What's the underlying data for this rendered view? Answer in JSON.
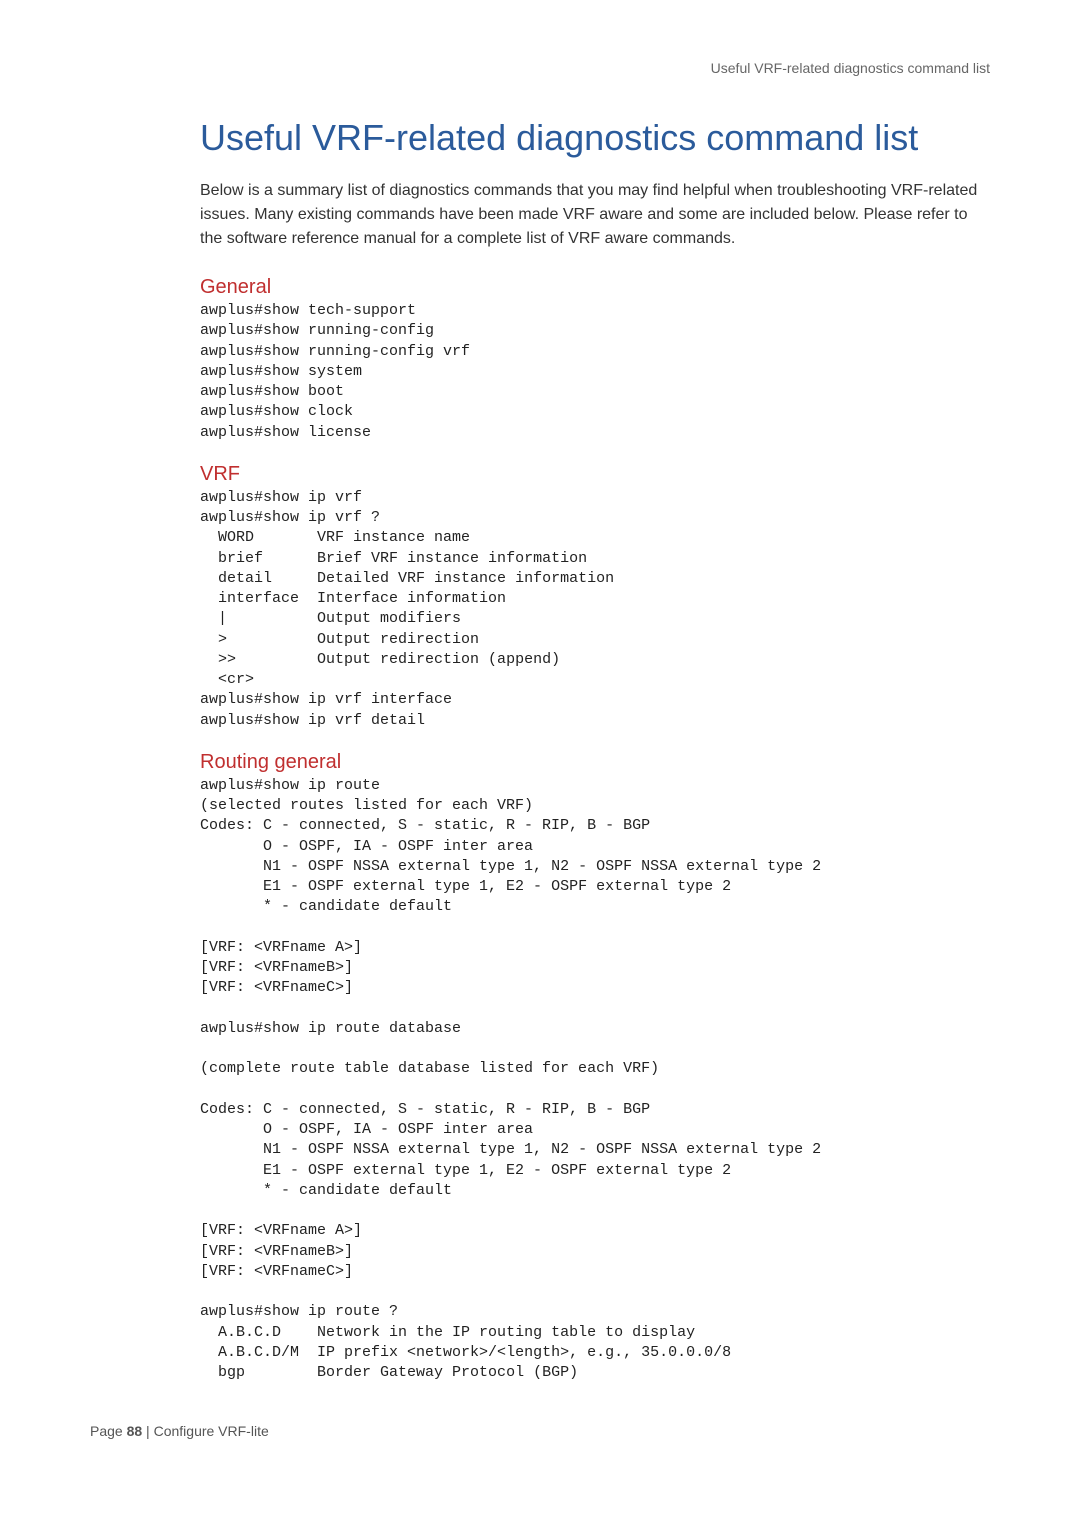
{
  "running_head": "Useful VRF-related diagnostics command list",
  "title": "Useful VRF-related diagnostics command list",
  "intro": "Below is a summary list of diagnostics commands that you may find helpful when troubleshooting VRF-related issues. Many existing commands have been made VRF aware and some are included below. Please refer to the software reference manual for a complete list of VRF aware commands.",
  "sections": {
    "general": {
      "heading": "General",
      "code": "awplus#show tech-support\nawplus#show running-config\nawplus#show running-config vrf\nawplus#show system\nawplus#show boot\nawplus#show clock\nawplus#show license"
    },
    "vrf": {
      "heading": "VRF",
      "code": "awplus#show ip vrf\nawplus#show ip vrf ?\n  WORD       VRF instance name\n  brief      Brief VRF instance information\n  detail     Detailed VRF instance information\n  interface  Interface information\n  |          Output modifiers\n  >          Output redirection\n  >>         Output redirection (append)\n  <cr>\nawplus#show ip vrf interface\nawplus#show ip vrf detail"
    },
    "routing": {
      "heading": "Routing general",
      "code": "awplus#show ip route\n(selected routes listed for each VRF)\nCodes: C - connected, S - static, R - RIP, B - BGP\n       O - OSPF, IA - OSPF inter area\n       N1 - OSPF NSSA external type 1, N2 - OSPF NSSA external type 2\n       E1 - OSPF external type 1, E2 - OSPF external type 2\n       * - candidate default\n\n[VRF: <VRFname A>]\n[VRF: <VRFnameB>]\n[VRF: <VRFnameC>]\n\nawplus#show ip route database\n\n(complete route table database listed for each VRF)\n\nCodes: C - connected, S - static, R - RIP, B - BGP\n       O - OSPF, IA - OSPF inter area\n       N1 - OSPF NSSA external type 1, N2 - OSPF NSSA external type 2\n       E1 - OSPF external type 1, E2 - OSPF external type 2\n       * - candidate default\n\n[VRF: <VRFname A>]\n[VRF: <VRFnameB>]\n[VRF: <VRFnameC>]\n\nawplus#show ip route ?\n  A.B.C.D    Network in the IP routing table to display\n  A.B.C.D/M  IP prefix <network>/<length>, e.g., 35.0.0.0/8\n  bgp        Border Gateway Protocol (BGP)"
    }
  },
  "footer": {
    "page_label": "Page",
    "page_number": "88",
    "separator": " |  ",
    "doc_title": "Configure VRF-lite"
  }
}
